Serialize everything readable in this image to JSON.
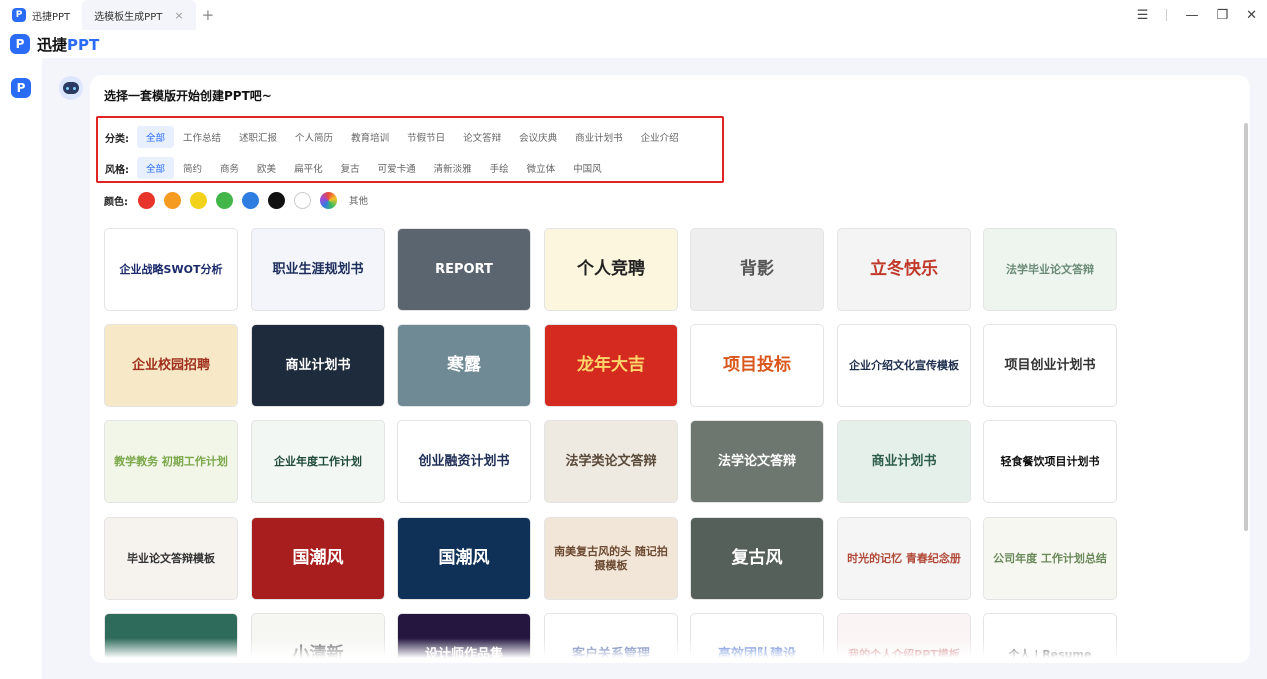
{
  "window": {
    "tabs": [
      {
        "label": "迅捷PPT"
      },
      {
        "label": "选模板生成PPT"
      }
    ],
    "close_tab_glyph": "×",
    "new_tab_glyph": "+",
    "controls": {
      "menu": "☰",
      "minimize": "—",
      "restore": "❐",
      "close": "✕"
    }
  },
  "brand": {
    "logo_glyph": "P",
    "name_part1": "迅捷",
    "name_part2": "PPT"
  },
  "main": {
    "title": "选择一套模版开始创建PPT吧~",
    "category": {
      "label": "分类:",
      "options": [
        "全部",
        "工作总结",
        "述职汇报",
        "个人简历",
        "教育培训",
        "节假节日",
        "论文答辩",
        "会议庆典",
        "商业计划书",
        "企业介绍"
      ],
      "selected_index": 0
    },
    "style": {
      "label": "风格:",
      "options": [
        "全部",
        "简约",
        "商务",
        "欧美",
        "扁平化",
        "复古",
        "可爱卡通",
        "清新淡雅",
        "手绘",
        "微立体",
        "中国风"
      ],
      "selected_index": 0
    },
    "color": {
      "label": "颜色:",
      "swatches": [
        "#e8352c",
        "#f59b22",
        "#f2d21b",
        "#43b649",
        "#2f7de1",
        "#111111",
        "#ffffff",
        "multi"
      ],
      "other_label": "其他"
    }
  },
  "templates": [
    {
      "title": "企业战略SWOT分析",
      "bg": "#ffffff",
      "fg": "#1a2a6b"
    },
    {
      "title": "职业生涯规划书",
      "bg": "#f3f5fa",
      "fg": "#1d2e5c"
    },
    {
      "title": "REPORT",
      "bg": "#5b6570",
      "fg": "#ffffff"
    },
    {
      "title": "个人竞聘",
      "bg": "#fdf6df",
      "fg": "#222222"
    },
    {
      "title": "背影",
      "bg": "#eeeeee",
      "fg": "#555555"
    },
    {
      "title": "立冬快乐",
      "bg": "#f4f4f4",
      "fg": "#c0392b"
    },
    {
      "title": "法学毕业论文答辩",
      "bg": "#eef5ef",
      "fg": "#6b8c77"
    },
    {
      "title": "企业校园招聘",
      "bg": "#f7e9c8",
      "fg": "#a0301c"
    },
    {
      "title": "商业计划书",
      "bg": "#1e2b3c",
      "fg": "#ffffff"
    },
    {
      "title": "寒露",
      "bg": "#6f8a95",
      "fg": "#ffffff"
    },
    {
      "title": "龙年大吉",
      "bg": "#d42a1f",
      "fg": "#ffd66b"
    },
    {
      "title": "项目投标",
      "bg": "#ffffff",
      "fg": "#d9571d"
    },
    {
      "title": "企业介绍文化宣传模板",
      "bg": "#ffffff",
      "fg": "#1d2e4c"
    },
    {
      "title": "项目创业计划书",
      "bg": "#ffffff",
      "fg": "#333333"
    },
    {
      "title": "教学教务 初期工作计划",
      "bg": "#f2f6e8",
      "fg": "#7aa84a"
    },
    {
      "title": "企业年度工作计划",
      "bg": "#f3f7f3",
      "fg": "#1f4a38"
    },
    {
      "title": "创业融资计划书",
      "bg": "#ffffff",
      "fg": "#1f2e55"
    },
    {
      "title": "法学类论文答辩",
      "bg": "#eee9e1",
      "fg": "#5a4a3a"
    },
    {
      "title": "法学论文答辩",
      "bg": "#6d7770",
      "fg": "#ffffff"
    },
    {
      "title": "商业计划书",
      "bg": "#e6f0ea",
      "fg": "#2e5e4e"
    },
    {
      "title": "轻食餐饮项目计划书",
      "bg": "#ffffff",
      "fg": "#111111"
    },
    {
      "title": "毕业论文答辩模板",
      "bg": "#f6f3ee",
      "fg": "#333333"
    },
    {
      "title": "国潮风",
      "bg": "#a81e1e",
      "fg": "#ffffff"
    },
    {
      "title": "国潮风",
      "bg": "#0f3158",
      "fg": "#ffffff"
    },
    {
      "title": "南美复古风的头 随记拍摄模板",
      "bg": "#f2e6d9",
      "fg": "#6d4a32"
    },
    {
      "title": "复古风",
      "bg": "#55605a",
      "fg": "#ffffff"
    },
    {
      "title": "时光的记忆 青春纪念册",
      "bg": "#f5f5f5",
      "fg": "#b24a3a"
    },
    {
      "title": "公司年度 工作计划总结",
      "bg": "#f7f7f2",
      "fg": "#6a8a5a"
    },
    {
      "title": "",
      "bg": "#2f6b5a",
      "fg": "#ffffff"
    },
    {
      "title": "小清新",
      "bg": "#f6f7f3",
      "fg": "#555555"
    },
    {
      "title": "设计师作品集",
      "bg": "#24163f",
      "fg": "#ffffff"
    },
    {
      "title": "客户关系管理",
      "bg": "#ffffff",
      "fg": "#2b4a9b"
    },
    {
      "title": "高效团队建设",
      "bg": "#ffffff",
      "fg": "#2a57c8"
    },
    {
      "title": "我的个人介绍PPT模板",
      "bg": "#fbf4f4",
      "fg": "#c25a5a"
    },
    {
      "title": "个人 | Resume",
      "bg": "#ffffff",
      "fg": "#222222"
    }
  ]
}
